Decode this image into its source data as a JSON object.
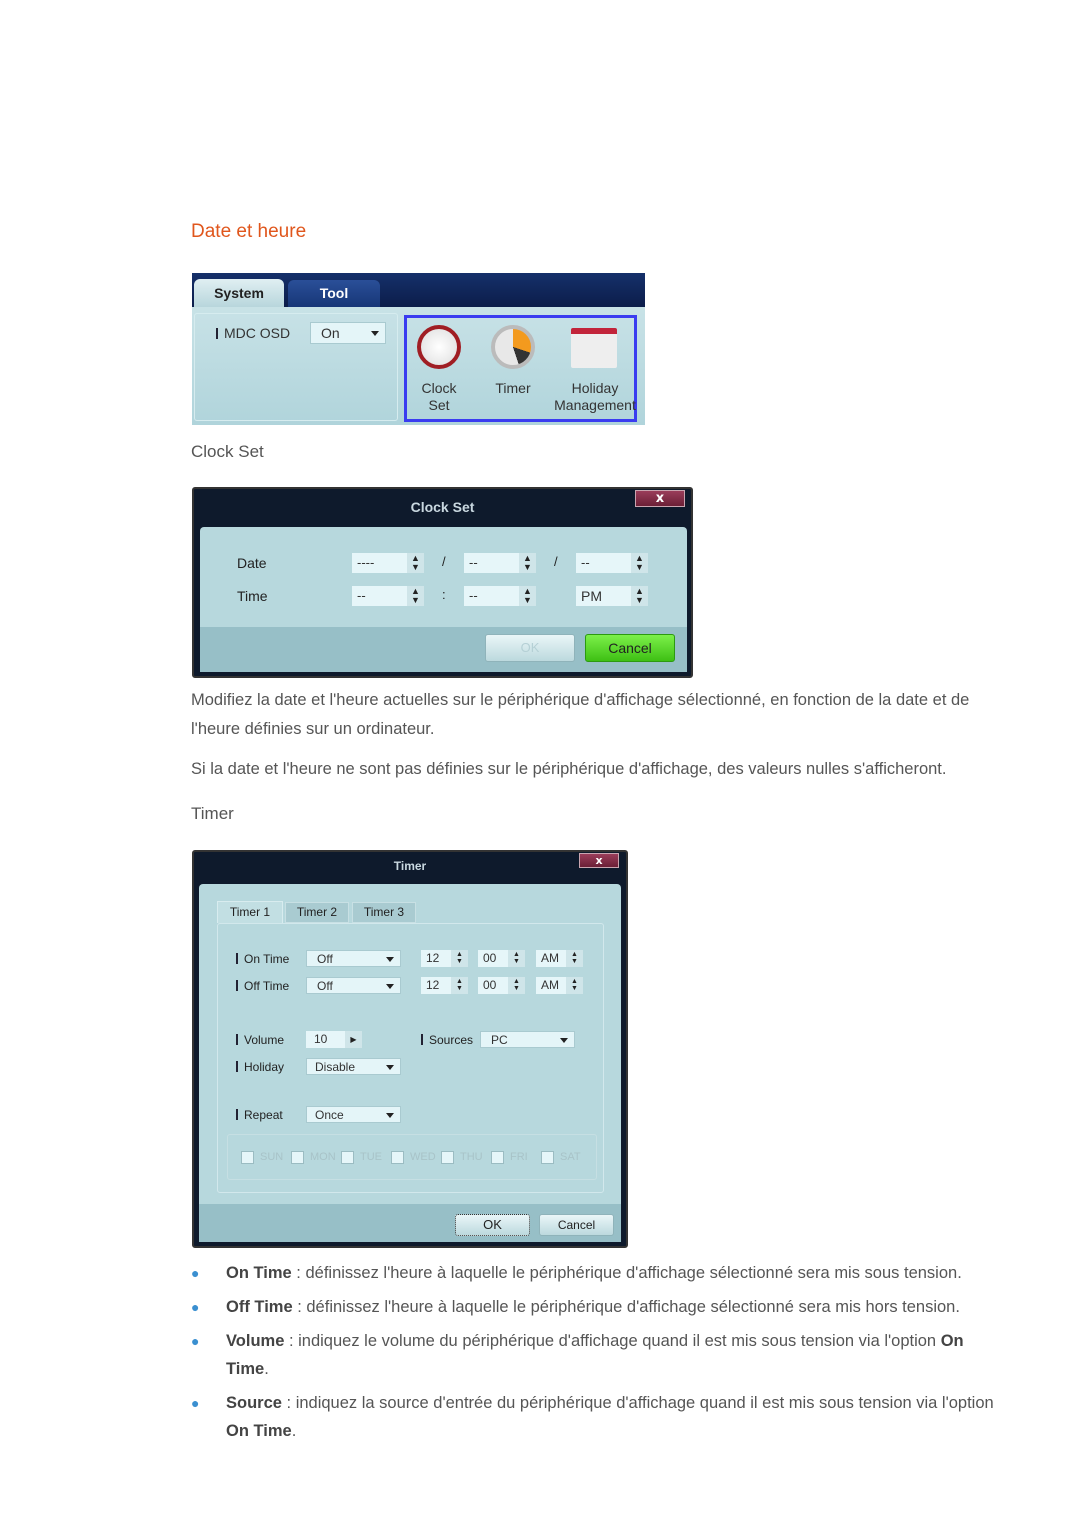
{
  "headings": {
    "section": "Date et heure",
    "clock_set": "Clock Set",
    "timer": "Timer"
  },
  "screenshot_menu": {
    "tabs": [
      "System",
      "Tool"
    ],
    "mdc_osd_label": "MDC OSD",
    "mdc_osd_value": "On",
    "icons": [
      {
        "name": "clock-icon",
        "label1": "Clock",
        "label2": "Set"
      },
      {
        "name": "timer-icon",
        "label1": "Timer",
        "label2": ""
      },
      {
        "name": "calendar-icon",
        "label1": "Holiday",
        "label2": "Management"
      }
    ],
    "highlight_color": "#3a3cf0"
  },
  "clock_dialog": {
    "title": "Clock Set",
    "close": "x",
    "date_label": "Date",
    "time_label": "Time",
    "date_values": [
      "----",
      "--",
      "--"
    ],
    "date_sep": "/",
    "time_values": [
      "--",
      "--",
      "PM"
    ],
    "time_sep": ":",
    "ok": "OK",
    "cancel": "Cancel",
    "cancel_color": "#44d21a"
  },
  "paragraphs": [
    "Modifiez la date et l'heure actuelles sur le périphérique d'affichage sélectionné, en fonction de la date et de l'heure définies sur un ordinateur.",
    "Si la date et l'heure ne sont pas définies sur le périphérique d'affichage, des valeurs nulles s'afficheront."
  ],
  "timer_dialog": {
    "title": "Timer",
    "close": "x",
    "tabs": [
      "Timer 1",
      "Timer 2",
      "Timer 3"
    ],
    "on_time": {
      "label": "On Time",
      "mode": "Off",
      "hour": "12",
      "minute": "00",
      "ampm": "AM"
    },
    "off_time": {
      "label": "Off Time",
      "mode": "Off",
      "hour": "12",
      "minute": "00",
      "ampm": "AM"
    },
    "volume": {
      "label": "Volume",
      "value": "10"
    },
    "sources": {
      "label": "Sources",
      "value": "PC"
    },
    "holiday": {
      "label": "Holiday",
      "value": "Disable"
    },
    "repeat": {
      "label": "Repeat",
      "value": "Once"
    },
    "days": [
      "SUN",
      "MON",
      "TUE",
      "WED",
      "THU",
      "FRI",
      "SAT"
    ],
    "ok": "OK",
    "cancel": "Cancel"
  },
  "bullets": [
    {
      "term": "On Time",
      "text": " : définissez l'heure à laquelle le périphérique d'affichage sélectionné sera mis sous tension."
    },
    {
      "term": "Off Time",
      "text": " : définissez l'heure à laquelle le périphérique d'affichage sélectionné sera mis hors tension."
    },
    {
      "term": "Volume",
      "text": " : indiquez le volume du périphérique d'affichage quand il est mis sous tension via l'option ",
      "term2": "On Time",
      "end": "."
    },
    {
      "term": "Source",
      "text": " : indiquez la source d'entrée du périphérique d'affichage quand il est mis sous tension via l'option ",
      "term2": "On Time",
      "end": "."
    }
  ]
}
